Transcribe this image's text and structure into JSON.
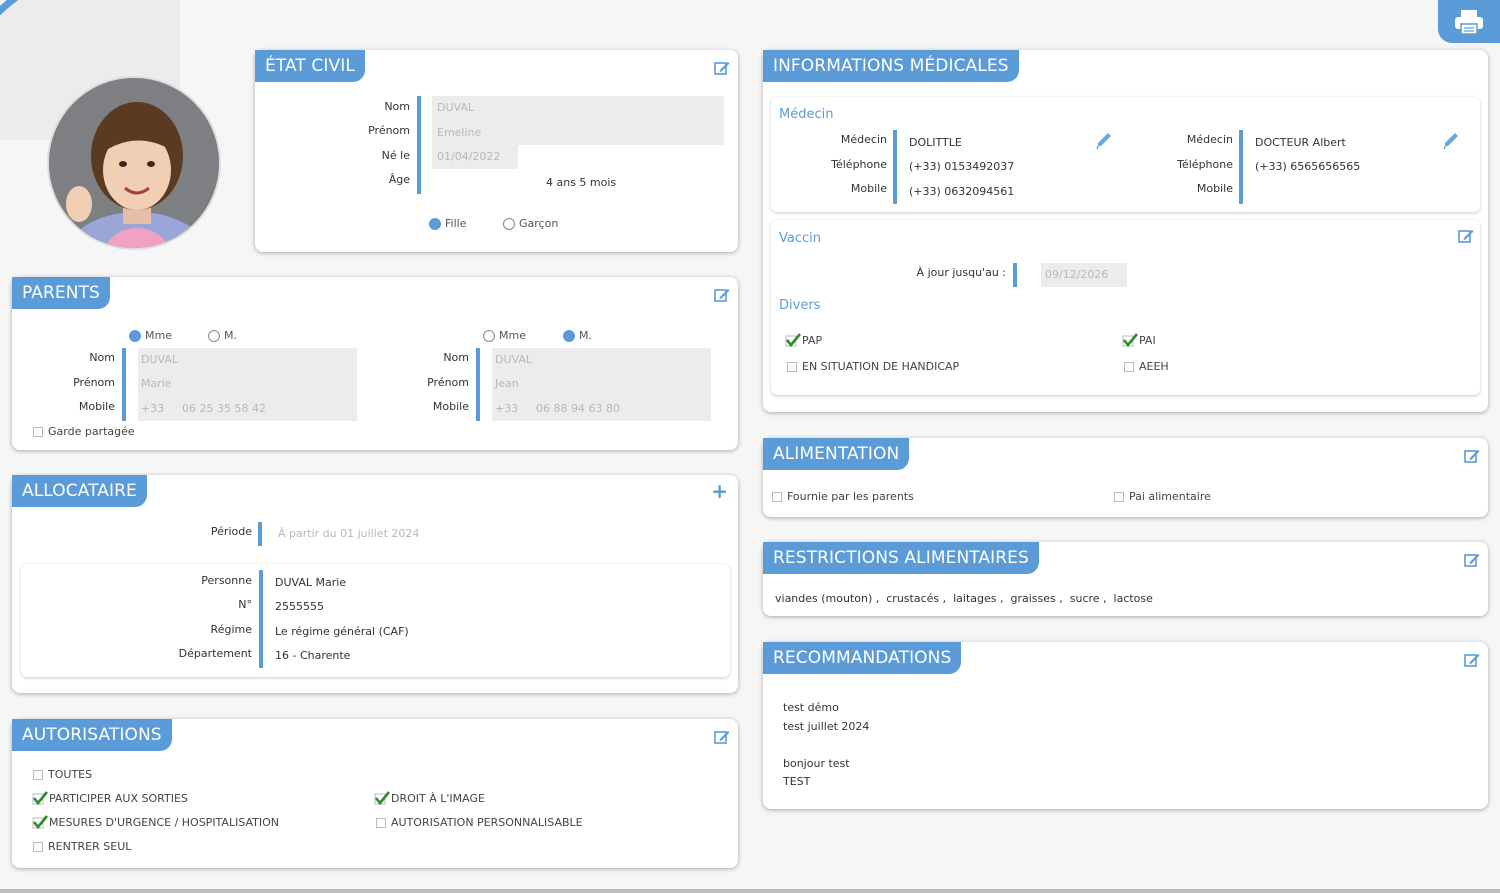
{
  "header": {
    "print_icon": "printer-icon"
  },
  "child": {
    "photo_alt": "child-photo"
  },
  "etat_civil": {
    "title": "ÉTAT CIVIL",
    "nom_label": "Nom",
    "nom_value": "DUVAL",
    "prenom_label": "Prénom",
    "prenom_value": "Emeline",
    "ne_label": "Né le",
    "ne_value": "01/04/2022",
    "age_label": "Âge",
    "age_value": "4 ans 5 mois",
    "fille": "Fille",
    "garcon": "Garçon"
  },
  "parents": {
    "title": "PARENTS",
    "p1": {
      "mme": "Mme",
      "m": "M.",
      "nom": "DUVAL",
      "prenom": "Marie",
      "indicatif": "+33",
      "mobile": "06 25 35 58 42"
    },
    "p2": {
      "mme": "Mme",
      "m": "M.",
      "nom": "DUVAL",
      "prenom": "Jean",
      "indicatif": "+33",
      "mobile": "06 88 94 63 80"
    },
    "nom_label": "Nom",
    "prenom_label": "Prénom",
    "mobile_label": "Mobile",
    "garde": "Garde partagée"
  },
  "allocataire": {
    "title": "ALLOCATAIRE",
    "periode_label": "Période",
    "periode_value": "À partir du 01 juillet 2024",
    "personne_label": "Personne",
    "personne_value": "DUVAL Marie",
    "no_label": "N°",
    "no_value": "2555555",
    "regime_label": "Régime",
    "regime_value": "Le régime général (CAF)",
    "dept_label": "Département",
    "dept_value": "16 - Charente"
  },
  "autorisations": {
    "title": "AUTORISATIONS",
    "toutes": "TOUTES",
    "sorties": "PARTICIPER AUX SORTIES",
    "urgence": "MESURES D'URGENCE / HOSPITALISATION",
    "rentrer": "RENTRER SEUL",
    "image": "DROIT À L'IMAGE",
    "perso": "AUTORISATION PERSONNALISABLE"
  },
  "medical": {
    "title": "INFORMATIONS MÉDICALES",
    "medecin_title": "Médecin",
    "medecin_label": "Médecin",
    "telephone_label": "Téléphone",
    "mobile_label": "Mobile",
    "m1": {
      "nom": "DOLITTLE",
      "tel": "(+33) 0153492037",
      "mobile": "(+33) 0632094561"
    },
    "m2": {
      "nom": "DOCTEUR Albert",
      "tel": "(+33) 6565656565"
    },
    "vaccin_title": "Vaccin",
    "vaccin_label": "À jour jusqu'au :",
    "vaccin_value": "09/12/2026",
    "divers_title": "Divers",
    "pap": "PAP",
    "pai": "PAI",
    "handicap": "EN SITUATION DE HANDICAP",
    "aeeh": "AEEH"
  },
  "alimentation": {
    "title": "ALIMENTATION",
    "fournie": "Fournie par les parents",
    "pai": "Pai alimentaire"
  },
  "restrictions": {
    "title": "RESTRICTIONS ALIMENTAIRES",
    "items": "viandes (mouton) ,  crustacés ,  laitages ,  graisses ,  sucre ,  lactose"
  },
  "recommandations": {
    "title": "RECOMMANDATIONS",
    "line1": "test démo",
    "line2": "test juillet 2024",
    "line3": "bonjour test",
    "line4": "TEST"
  },
  "colors": {
    "accent": "#5b9bd8",
    "check": "#2e8b2e"
  }
}
